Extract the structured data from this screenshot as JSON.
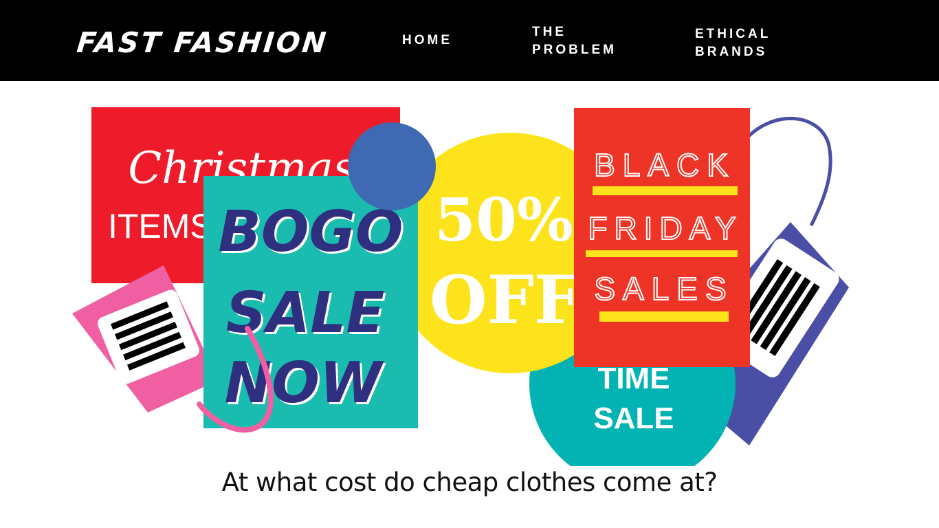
{
  "header": {
    "logo": "FAST FASHION",
    "nav": [
      {
        "lines": [
          "HOME"
        ]
      },
      {
        "lines": [
          "THE",
          "PROBLEM"
        ]
      },
      {
        "lines": [
          "ETHICAL",
          "BRANDS"
        ]
      }
    ]
  },
  "hero": {
    "christmas_sign": {
      "line1": "Christmas",
      "line2": "ITEMS"
    },
    "bogo_sign": {
      "line1": "BOGO",
      "line2": "SALE",
      "line3": "NOW"
    },
    "percent_sign": {
      "line1": "50%",
      "line2": "OFF"
    },
    "time_sign": {
      "line1": "TIME",
      "line2": "SALE"
    },
    "black_friday_sign": {
      "line1": "BLACK",
      "line2": "FRIDAY",
      "line3": "SALES"
    }
  },
  "tagline": "At what cost do cheap clothes come at?",
  "colors": {
    "header_bg": "#000000",
    "red": "#ee1c2a",
    "teal": "#1bbcb0",
    "yellow": "#fde31b",
    "blue": "#3f6ab3",
    "orange_red": "#ee3426",
    "navy": "#4a4ea4",
    "pink": "#f15fa3",
    "cyan": "#03b2b3"
  },
  "icons": [
    "barcode-icon",
    "price-tag-icon"
  ]
}
